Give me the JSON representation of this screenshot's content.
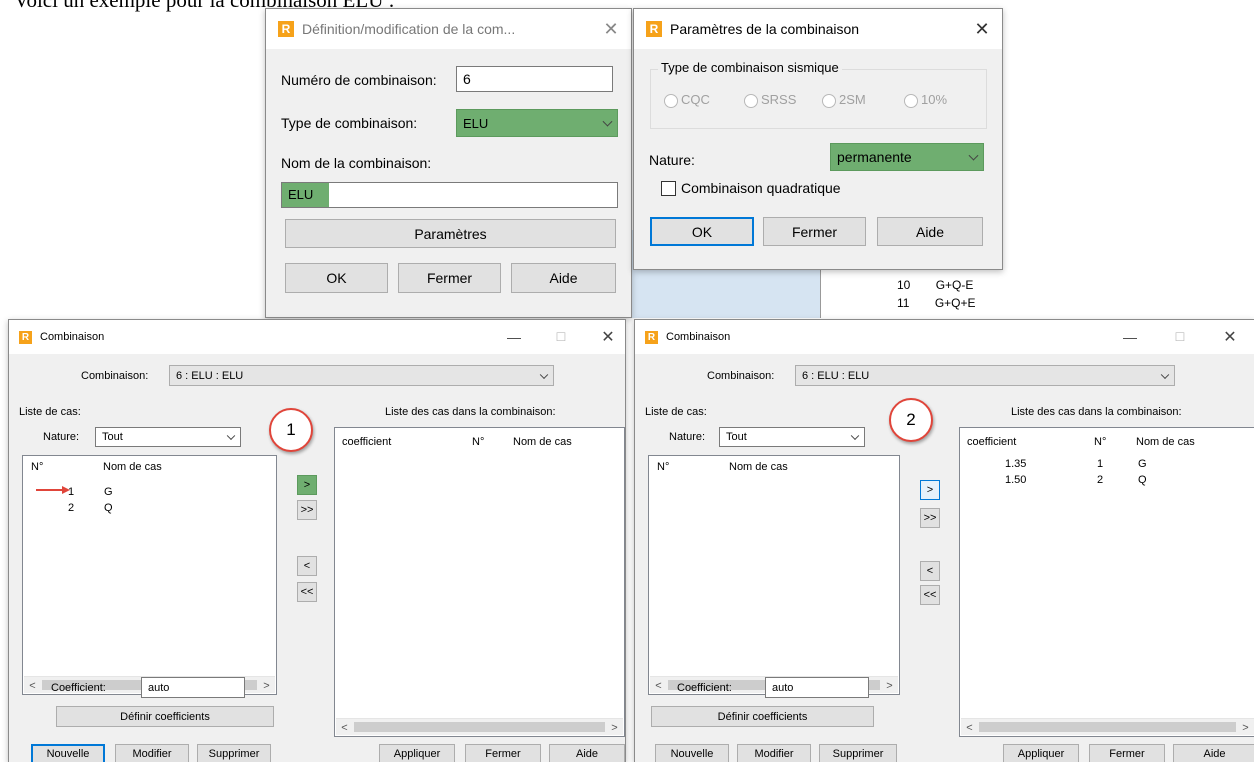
{
  "caption": "Voici un exemple pour la combinaison ELU :",
  "logo_letter": "R",
  "colors": {
    "highlight": "#6fae70",
    "arrow": "#e0453a",
    "logo": "#f6a21a",
    "focus": "#0078d7"
  },
  "def_dialog": {
    "title": "Définition/modification de la com...",
    "number_label": "Numéro de combinaison:",
    "number_value": "6",
    "type_label": "Type de combinaison:",
    "type_value": "ELU",
    "name_label": "Nom de la combinaison:",
    "name_value": "ELU",
    "params_btn": "Paramètres",
    "ok": "OK",
    "close": "Fermer",
    "help": "Aide"
  },
  "params_dialog": {
    "title": "Paramètres de la combinaison",
    "group_title": "Type de combinaison sismique",
    "radios": [
      "CQC",
      "SRSS",
      "2SM",
      "10%"
    ],
    "nature_label": "Nature:",
    "nature_value": "permanente",
    "quadratic_label": "Combinaison quadratique",
    "ok": "OK",
    "close": "Fermer",
    "help": "Aide"
  },
  "bg_list": {
    "rows": [
      {
        "num": "10",
        "name": "G+Q-E"
      },
      {
        "num": "11",
        "name": "G+Q+E"
      }
    ]
  },
  "combo_left": {
    "title": "Combinaison",
    "combo_label": "Combinaison:",
    "combo_value": "6 : ELU : ELU",
    "cases_label": "Liste de cas:",
    "nature_label": "Nature:",
    "nature_value": "Tout",
    "left_headers": [
      "N°",
      "Nom de cas"
    ],
    "left_rows": [
      {
        "num": "1",
        "name": "G"
      },
      {
        "num": "2",
        "name": "Q"
      }
    ],
    "right_title": "Liste des cas dans la combinaison:",
    "right_headers": [
      "coefficient",
      "N°",
      "Nom de cas"
    ],
    "right_rows": [],
    "transfer": [
      ">",
      ">>",
      "<",
      "<<"
    ],
    "coef_label": "Coefficient:",
    "coef_value": "auto",
    "define_btn": "Définir coefficients",
    "new": "Nouvelle",
    "modify": "Modifier",
    "delete": "Supprimer",
    "apply": "Appliquer",
    "close": "Fermer",
    "help": "Aide",
    "step": "1"
  },
  "combo_right": {
    "title": "Combinaison",
    "combo_label": "Combinaison:",
    "combo_value": "6 : ELU : ELU",
    "cases_label": "Liste de cas:",
    "nature_label": "Nature:",
    "nature_value": "Tout",
    "left_headers": [
      "N°",
      "Nom de cas"
    ],
    "left_rows": [],
    "right_title": "Liste des cas dans la combinaison:",
    "right_headers": [
      "coefficient",
      "N°",
      "Nom de cas"
    ],
    "right_rows": [
      {
        "coef": "1.35",
        "num": "1",
        "name": "G"
      },
      {
        "coef": "1.50",
        "num": "2",
        "name": "Q"
      }
    ],
    "transfer": [
      ">",
      ">>",
      "<",
      "<<"
    ],
    "coef_label": "Coefficient:",
    "coef_value": "auto",
    "define_btn": "Définir coefficients",
    "new": "Nouvelle",
    "modify": "Modifier",
    "delete": "Supprimer",
    "apply": "Appliquer",
    "close": "Fermer",
    "help": "Aide",
    "step": "2"
  }
}
